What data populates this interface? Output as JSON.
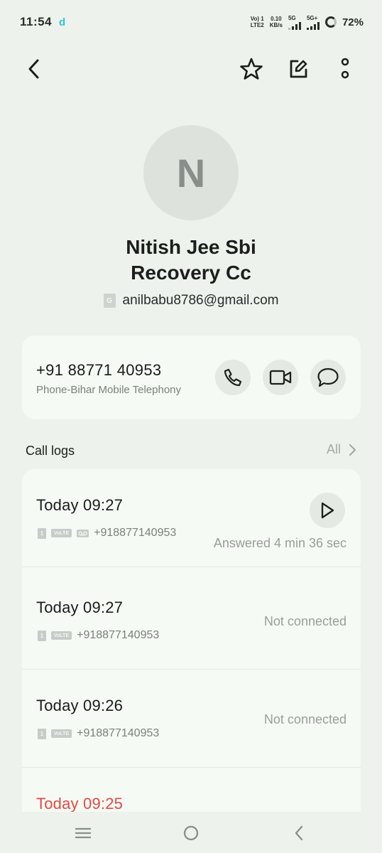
{
  "status_bar": {
    "time": "11:54",
    "notification_icon": "d",
    "sim1_top": "Vo) 1",
    "sim1_bottom": "LTE2",
    "speed_top": "0.10",
    "speed_bottom": "KB/s",
    "net1": "5G",
    "net2": "5G+",
    "battery": "72%"
  },
  "toolbar": {
    "back_icon": "chevron-left-icon",
    "favorite_icon": "star-outline-icon",
    "edit_icon": "edit-icon",
    "more_icon": "more-vertical-icon"
  },
  "contact": {
    "initial": "N",
    "name_line1": "Nitish Jee Sbi",
    "name_line2": "Recovery Cc",
    "account_badge": "G",
    "email": "anilbabu8786@gmail.com"
  },
  "phone_card": {
    "number": "+91 88771 40953",
    "type": "Phone-Bihar Mobile Telephony"
  },
  "call_logs": {
    "title": "Call logs",
    "all_label": "All",
    "entries": [
      {
        "time": "Today 09:27",
        "sim": "1",
        "volte": "VoLTE",
        "number": "+918877140953",
        "status": "Answered 4 min 36 sec"
      },
      {
        "time": "Today 09:27",
        "sim": "1",
        "volte": "VoLTE",
        "number": "+918877140953",
        "status": "Not connected"
      },
      {
        "time": "Today 09:26",
        "sim": "1",
        "volte": "VoLTE",
        "number": "+918877140953",
        "status": "Not connected"
      },
      {
        "time": "Today 09:25"
      }
    ]
  },
  "colors": {
    "background": "#edf2ec",
    "card": "#f6faf5",
    "missed": "#e04a45"
  }
}
